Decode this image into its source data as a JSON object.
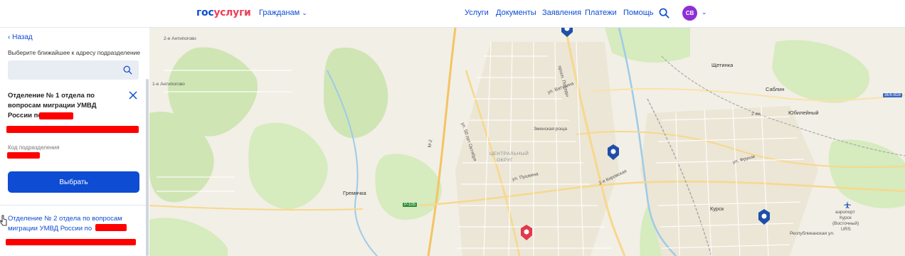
{
  "header": {
    "logo_part1": "гос",
    "logo_part2": "услуги",
    "citizens": "Гражданам",
    "nav": [
      "Услуги",
      "Документы",
      "Заявления",
      "Платежи",
      "Помощь"
    ],
    "avatar_initials": "СВ",
    "avatar_color": "#8e2fd6",
    "brand_blue": "#0d4cd3",
    "brand_red": "#ee3f58"
  },
  "sidebar": {
    "back": "Назад",
    "hint": "Выберите ближайшее к адресу подразделение",
    "search_value": "",
    "card1": {
      "title": "Отделение № 1 отдела по вопросам миграции УМВД России по",
      "code_label": "Код подразделения",
      "select_button": "Выбрать"
    },
    "card2": {
      "title": "Отделение № 2 отдела по вопросам миграции УМВД России по"
    },
    "redaction_color": "#ff0000"
  },
  "map": {
    "labels": {
      "antipovo2": "2-е Антипогово",
      "antipovo1": "1-е Антипогово",
      "shchetinka": "Щетинка",
      "sablin": "Саблин",
      "yubileyny": "Юбилейный",
      "km2": "2 км",
      "zmenskaya": "Зменская роща",
      "central": "ЦЕНТРАЛЬНЫЙ",
      "okrug": "ОКРУГ",
      "gremyachka": "Гремячка",
      "kursk": "Курск",
      "airport1": "аэропорт",
      "airport2": "Курск",
      "airport3": "(Восточный)",
      "airport4": "URS",
      "str_vatutina": "ул. Ватутина",
      "str_pushkina": "ул. Пушкина",
      "str_pobedy": "просп. Победы",
      "str_m2": "М-2",
      "str_oktyabrya": "ул. 50 лет Октября",
      "str_frunze": "ул. Фрунзе",
      "str_2kirov": "2-я Кировская",
      "str_respublikanskaya": "Республиканская ул."
    },
    "shields": {
      "r105": "Р-105",
      "a8": "3ЕК-818"
    },
    "pin_blue": "#1f4fa8",
    "pin_red": "#e2384d"
  }
}
